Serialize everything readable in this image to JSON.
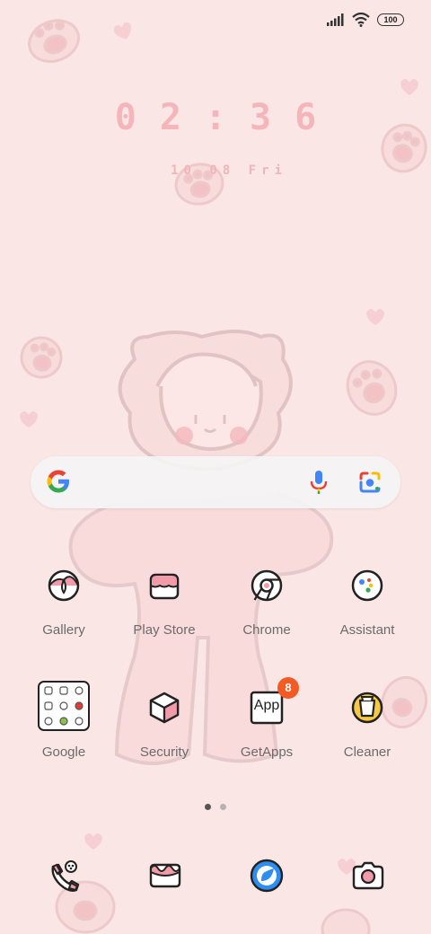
{
  "status_bar": {
    "battery_level": "100",
    "icons": [
      "signal-icon",
      "wifi-icon",
      "battery-icon"
    ]
  },
  "clock": {
    "time": "02:36",
    "date": "10 08 Fri"
  },
  "search_bar": {
    "icons": [
      "google-logo-icon",
      "microphone-icon",
      "google-lens-icon"
    ]
  },
  "apps": [
    {
      "label": "Gallery",
      "icon": "gallery-icon"
    },
    {
      "label": "Play Store",
      "icon": "play-store-icon"
    },
    {
      "label": "Chrome",
      "icon": "chrome-icon"
    },
    {
      "label": "Assistant",
      "icon": "assistant-icon"
    },
    {
      "label": "Google",
      "icon": "google-folder-icon"
    },
    {
      "label": "Security",
      "icon": "security-icon"
    },
    {
      "label": "GetApps",
      "icon": "getapps-icon",
      "badge": "8",
      "icon_text": "App"
    },
    {
      "label": "Cleaner",
      "icon": "cleaner-icon"
    }
  ],
  "page_indicator": {
    "pages": 2,
    "active": 1
  },
  "dock": [
    {
      "icon": "phone-icon"
    },
    {
      "icon": "messages-icon"
    },
    {
      "icon": "browser-icon"
    },
    {
      "icon": "camera-icon"
    }
  ],
  "colors": {
    "background": "#fbe6e6",
    "accent_pink": "#f4b5bb",
    "badge": "#f35a24"
  }
}
